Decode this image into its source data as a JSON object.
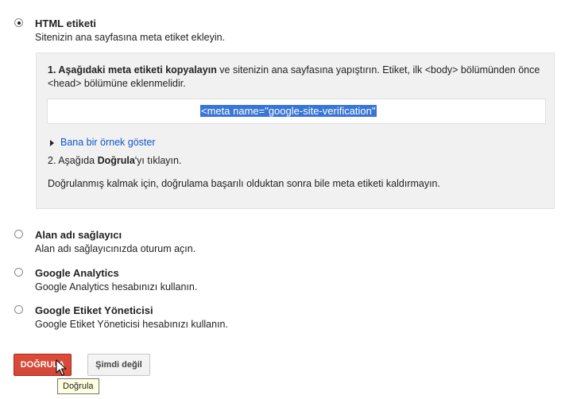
{
  "options": [
    {
      "title": "HTML etiketi",
      "desc": "Sitenizin ana sayfasına meta etiket ekleyin.",
      "selected": true
    },
    {
      "title": "Alan adı sağlayıcı",
      "desc": "Alan adı sağlayıcınızda oturum açın.",
      "selected": false
    },
    {
      "title": "Google Analytics",
      "desc": "Google Analytics hesabınızı kullanın.",
      "selected": false
    },
    {
      "title": "Google Etiket Yöneticisi",
      "desc": "Google Etiket Yöneticisi hesabınızı kullanın.",
      "selected": false
    }
  ],
  "panel": {
    "step1_bold": "1. Aşağıdaki meta etiketi kopyalayın",
    "step1_rest": " ve sitenizin ana sayfasına yapıştırın. Etiket, ilk <body> bölümünden önce <head> bölümüne eklenmelidir.",
    "meta_tag": "<meta name=\"google-site-verification\"",
    "example_link": "Bana bir örnek göster",
    "step2_prefix": "2. Aşağıda ",
    "step2_bold": "Doğrula",
    "step2_suffix": "'yı tıklayın.",
    "note": "Doğrulanmış kalmak için, doğrulama başarılı olduktan sonra bile meta etiketi kaldırmayın."
  },
  "buttons": {
    "verify_label": "DOĞRULA",
    "later_label": "Şimdi değil"
  },
  "tooltip": "Doğrula",
  "colors": {
    "primary_button": "#d14836",
    "selection": "#3875d7",
    "link": "#1155cc"
  }
}
